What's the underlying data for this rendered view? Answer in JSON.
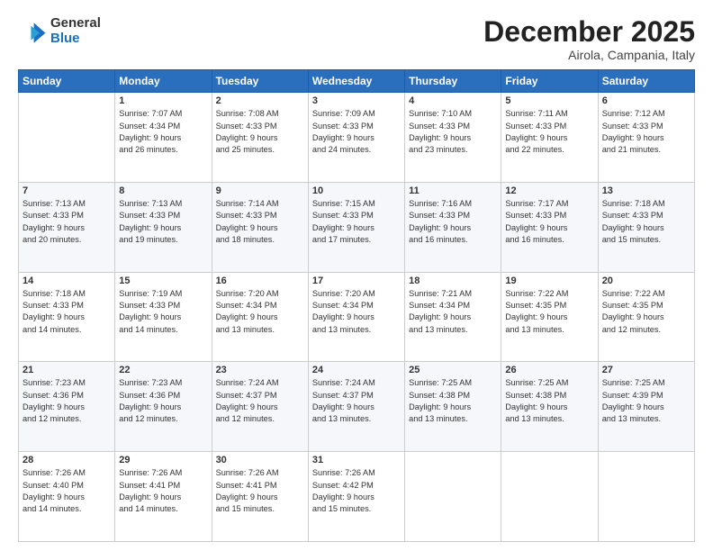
{
  "header": {
    "logo": {
      "general": "General",
      "blue": "Blue"
    },
    "title": "December 2025",
    "location": "Airola, Campania, Italy"
  },
  "calendar": {
    "days_of_week": [
      "Sunday",
      "Monday",
      "Tuesday",
      "Wednesday",
      "Thursday",
      "Friday",
      "Saturday"
    ],
    "weeks": [
      [
        {
          "day": "",
          "info": ""
        },
        {
          "day": "1",
          "info": "Sunrise: 7:07 AM\nSunset: 4:34 PM\nDaylight: 9 hours\nand 26 minutes."
        },
        {
          "day": "2",
          "info": "Sunrise: 7:08 AM\nSunset: 4:33 PM\nDaylight: 9 hours\nand 25 minutes."
        },
        {
          "day": "3",
          "info": "Sunrise: 7:09 AM\nSunset: 4:33 PM\nDaylight: 9 hours\nand 24 minutes."
        },
        {
          "day": "4",
          "info": "Sunrise: 7:10 AM\nSunset: 4:33 PM\nDaylight: 9 hours\nand 23 minutes."
        },
        {
          "day": "5",
          "info": "Sunrise: 7:11 AM\nSunset: 4:33 PM\nDaylight: 9 hours\nand 22 minutes."
        },
        {
          "day": "6",
          "info": "Sunrise: 7:12 AM\nSunset: 4:33 PM\nDaylight: 9 hours\nand 21 minutes."
        }
      ],
      [
        {
          "day": "7",
          "info": "Sunrise: 7:13 AM\nSunset: 4:33 PM\nDaylight: 9 hours\nand 20 minutes."
        },
        {
          "day": "8",
          "info": "Sunrise: 7:13 AM\nSunset: 4:33 PM\nDaylight: 9 hours\nand 19 minutes."
        },
        {
          "day": "9",
          "info": "Sunrise: 7:14 AM\nSunset: 4:33 PM\nDaylight: 9 hours\nand 18 minutes."
        },
        {
          "day": "10",
          "info": "Sunrise: 7:15 AM\nSunset: 4:33 PM\nDaylight: 9 hours\nand 17 minutes."
        },
        {
          "day": "11",
          "info": "Sunrise: 7:16 AM\nSunset: 4:33 PM\nDaylight: 9 hours\nand 16 minutes."
        },
        {
          "day": "12",
          "info": "Sunrise: 7:17 AM\nSunset: 4:33 PM\nDaylight: 9 hours\nand 16 minutes."
        },
        {
          "day": "13",
          "info": "Sunrise: 7:18 AM\nSunset: 4:33 PM\nDaylight: 9 hours\nand 15 minutes."
        }
      ],
      [
        {
          "day": "14",
          "info": "Sunrise: 7:18 AM\nSunset: 4:33 PM\nDaylight: 9 hours\nand 14 minutes."
        },
        {
          "day": "15",
          "info": "Sunrise: 7:19 AM\nSunset: 4:33 PM\nDaylight: 9 hours\nand 14 minutes."
        },
        {
          "day": "16",
          "info": "Sunrise: 7:20 AM\nSunset: 4:34 PM\nDaylight: 9 hours\nand 13 minutes."
        },
        {
          "day": "17",
          "info": "Sunrise: 7:20 AM\nSunset: 4:34 PM\nDaylight: 9 hours\nand 13 minutes."
        },
        {
          "day": "18",
          "info": "Sunrise: 7:21 AM\nSunset: 4:34 PM\nDaylight: 9 hours\nand 13 minutes."
        },
        {
          "day": "19",
          "info": "Sunrise: 7:22 AM\nSunset: 4:35 PM\nDaylight: 9 hours\nand 13 minutes."
        },
        {
          "day": "20",
          "info": "Sunrise: 7:22 AM\nSunset: 4:35 PM\nDaylight: 9 hours\nand 12 minutes."
        }
      ],
      [
        {
          "day": "21",
          "info": "Sunrise: 7:23 AM\nSunset: 4:36 PM\nDaylight: 9 hours\nand 12 minutes."
        },
        {
          "day": "22",
          "info": "Sunrise: 7:23 AM\nSunset: 4:36 PM\nDaylight: 9 hours\nand 12 minutes."
        },
        {
          "day": "23",
          "info": "Sunrise: 7:24 AM\nSunset: 4:37 PM\nDaylight: 9 hours\nand 12 minutes."
        },
        {
          "day": "24",
          "info": "Sunrise: 7:24 AM\nSunset: 4:37 PM\nDaylight: 9 hours\nand 13 minutes."
        },
        {
          "day": "25",
          "info": "Sunrise: 7:25 AM\nSunset: 4:38 PM\nDaylight: 9 hours\nand 13 minutes."
        },
        {
          "day": "26",
          "info": "Sunrise: 7:25 AM\nSunset: 4:38 PM\nDaylight: 9 hours\nand 13 minutes."
        },
        {
          "day": "27",
          "info": "Sunrise: 7:25 AM\nSunset: 4:39 PM\nDaylight: 9 hours\nand 13 minutes."
        }
      ],
      [
        {
          "day": "28",
          "info": "Sunrise: 7:26 AM\nSunset: 4:40 PM\nDaylight: 9 hours\nand 14 minutes."
        },
        {
          "day": "29",
          "info": "Sunrise: 7:26 AM\nSunset: 4:41 PM\nDaylight: 9 hours\nand 14 minutes."
        },
        {
          "day": "30",
          "info": "Sunrise: 7:26 AM\nSunset: 4:41 PM\nDaylight: 9 hours\nand 15 minutes."
        },
        {
          "day": "31",
          "info": "Sunrise: 7:26 AM\nSunset: 4:42 PM\nDaylight: 9 hours\nand 15 minutes."
        },
        {
          "day": "",
          "info": ""
        },
        {
          "day": "",
          "info": ""
        },
        {
          "day": "",
          "info": ""
        }
      ]
    ]
  }
}
